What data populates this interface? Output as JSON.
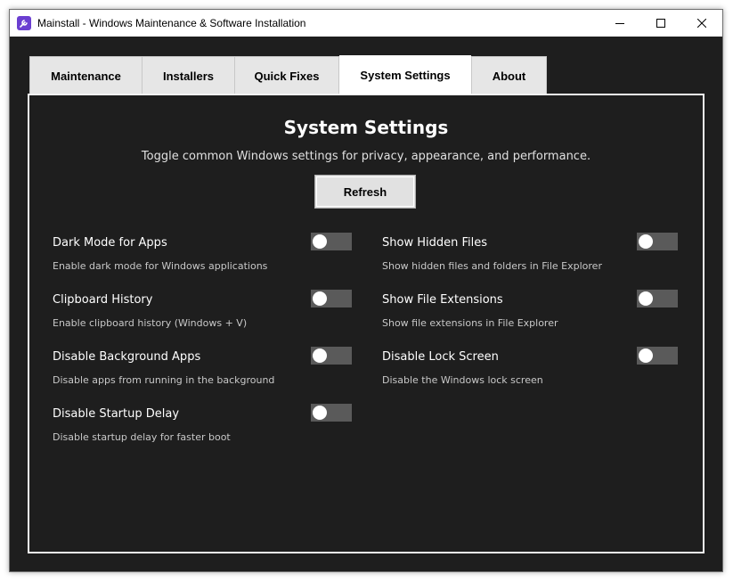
{
  "window": {
    "title": "Mainstall - Windows Maintenance & Software Installation",
    "accent": "#6b3fd1"
  },
  "tabs": [
    {
      "label": "Maintenance"
    },
    {
      "label": "Installers"
    },
    {
      "label": "Quick Fixes"
    },
    {
      "label": "System Settings",
      "active": true
    },
    {
      "label": "About"
    }
  ],
  "panel": {
    "title": "System Settings",
    "subtitle": "Toggle common Windows settings for privacy, appearance, and performance.",
    "refresh_label": "Refresh"
  },
  "settings": [
    {
      "label": "Dark Mode for Apps",
      "desc": "Enable dark mode for Windows applications",
      "enabled": false
    },
    {
      "label": "Show Hidden Files",
      "desc": "Show hidden files and folders in File Explorer",
      "enabled": false
    },
    {
      "label": "Clipboard History",
      "desc": "Enable clipboard history (Windows + V)",
      "enabled": false
    },
    {
      "label": "Show File Extensions",
      "desc": "Show file extensions in File Explorer",
      "enabled": false
    },
    {
      "label": "Disable Background Apps",
      "desc": "Disable apps from running in the background",
      "enabled": false
    },
    {
      "label": "Disable Lock Screen",
      "desc": "Disable the Windows lock screen",
      "enabled": false
    },
    {
      "label": "Disable Startup Delay",
      "desc": "Disable startup delay for faster boot",
      "enabled": false
    }
  ]
}
